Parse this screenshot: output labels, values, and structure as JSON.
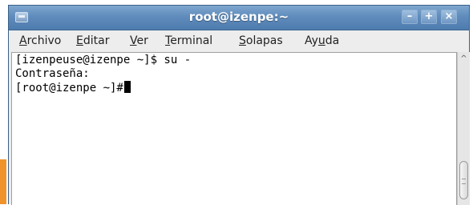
{
  "window": {
    "title": "root@izenpe:~"
  },
  "menubar": {
    "items": [
      {
        "label": "Archivo",
        "mnemonic": "A"
      },
      {
        "label": "Editar",
        "mnemonic": "E"
      },
      {
        "label": "Ver",
        "mnemonic": "V"
      },
      {
        "label": "Terminal",
        "mnemonic": "T"
      },
      {
        "label": "Solapas",
        "mnemonic": "S"
      },
      {
        "label": "Ayuda",
        "mnemonic": "u"
      }
    ]
  },
  "terminal": {
    "lines": [
      "[izenpeuse@izenpe ~]$ su -",
      "Contraseña:",
      "[root@izenpe ~]#"
    ]
  },
  "colors": {
    "titlebar": "#5f8cbc",
    "accent_strip": "#f0932b"
  },
  "icons": {
    "window_menu": "window-menu-icon",
    "minimize": "minimize-icon",
    "maximize": "maximize-icon",
    "close": "close-icon",
    "scroll_up": "scroll-up-arrow-icon"
  }
}
